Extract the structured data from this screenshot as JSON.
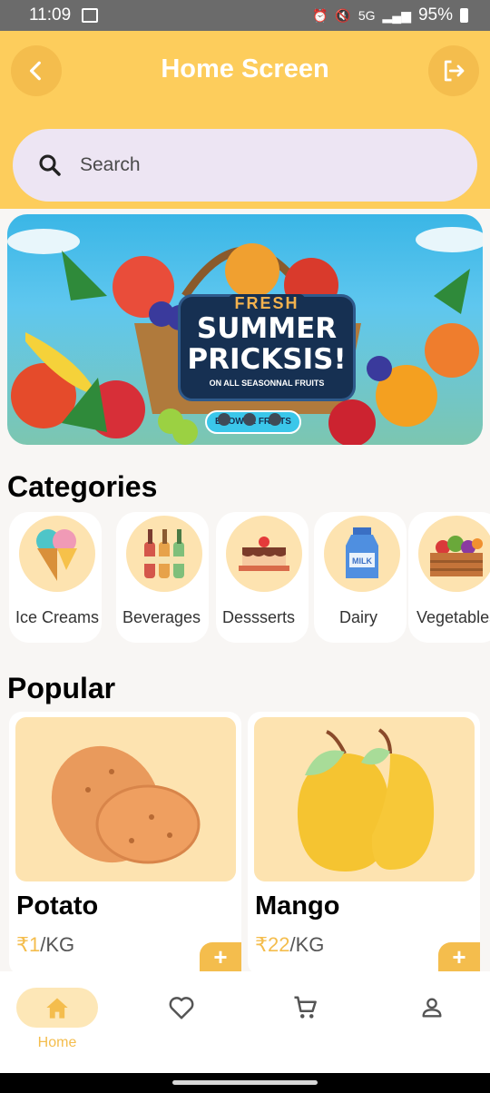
{
  "status_bar": {
    "time": "11:09",
    "battery": "95%",
    "network": "5G"
  },
  "header": {
    "title": "Home Screen",
    "back_icon": "arrow-left-icon",
    "logout_icon": "logout-icon"
  },
  "search": {
    "placeholder": "Search"
  },
  "banner": {
    "line1": "FRESH",
    "line2": "SUMMER",
    "line3": "PRICKSIS!",
    "line4": "ON ALL SEASONNAL FRUITS",
    "button": "BROWSE FRUITS"
  },
  "categories": {
    "title": "Categories",
    "items": [
      {
        "label": "Ice Creams",
        "icon": "ice-cream-icon"
      },
      {
        "label": "Beverages",
        "icon": "bottles-icon"
      },
      {
        "label": "Dessserts",
        "icon": "cake-icon"
      },
      {
        "label": "Dairy",
        "icon": "milk-icon"
      },
      {
        "label": "Vegetables",
        "icon": "vegetable-crate-icon"
      }
    ]
  },
  "popular": {
    "title": "Popular",
    "items": [
      {
        "name": "Potato",
        "currency": "₹",
        "price": "1",
        "unit": "/KG"
      },
      {
        "name": "Mango",
        "currency": "₹",
        "price": "22",
        "unit": "/KG"
      }
    ]
  },
  "bottom_nav": {
    "items": [
      {
        "label": "Home",
        "icon": "home-icon",
        "active": true
      },
      {
        "label": "",
        "icon": "heart-icon",
        "active": false
      },
      {
        "label": "",
        "icon": "cart-icon",
        "active": false
      },
      {
        "label": "",
        "icon": "profile-icon",
        "active": false
      }
    ]
  },
  "colors": {
    "accent": "#fdcd5c",
    "accent_dark": "#f4bd4d",
    "soft": "#fde3b0",
    "search_bg": "#ede5f3"
  }
}
